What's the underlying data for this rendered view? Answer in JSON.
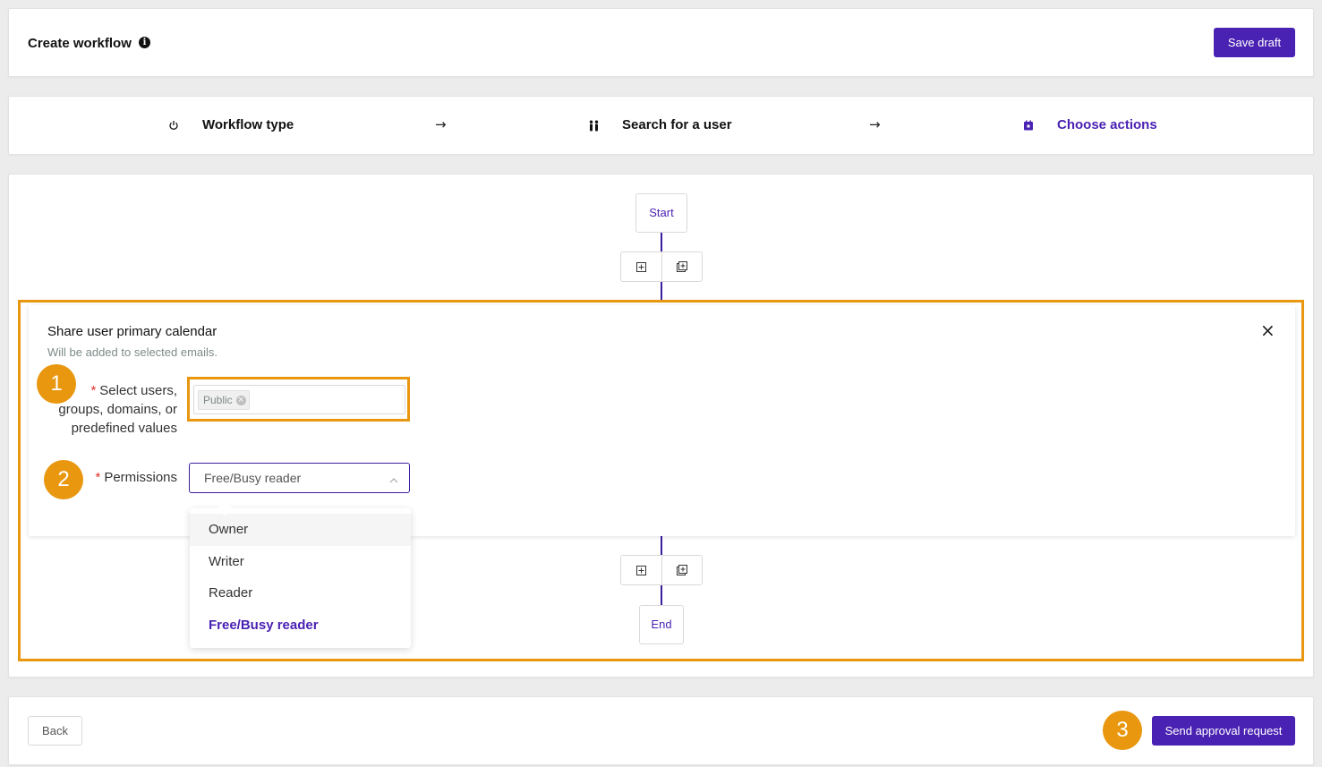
{
  "header": {
    "title": "Create workflow",
    "info_icon": "info-icon",
    "save_label": "Save draft"
  },
  "stepper": {
    "steps": [
      {
        "label": "Workflow type",
        "icon": "power-icon",
        "active": false
      },
      {
        "label": "Search for a user",
        "icon": "users-icon",
        "active": false
      },
      {
        "label": "Choose actions",
        "icon": "calendar-icon",
        "active": true
      }
    ],
    "separator_icon": "arrow-right-icon"
  },
  "flow": {
    "start_label": "Start",
    "end_label": "End",
    "add_icon": "add-action-icon",
    "duplicate_icon": "add-group-icon"
  },
  "action_panel": {
    "title": "Share user primary calendar",
    "subtitle": "Will be added to selected emails.",
    "users_field": {
      "required": "*",
      "label": "Select users, groups, domains, or predefined values",
      "tags": [
        "Public"
      ]
    },
    "permissions_field": {
      "required": "*",
      "label": "Permissions",
      "value": "Free/Busy reader",
      "options": [
        "Owner",
        "Writer",
        "Reader",
        "Free/Busy reader"
      ],
      "selected_index": 3,
      "hover_index": 0
    }
  },
  "annotations": {
    "badges": [
      "1",
      "2",
      "3"
    ],
    "highlight_color": "#e8970f"
  },
  "footer": {
    "back_label": "Back",
    "send_label": "Send approval request"
  },
  "colors": {
    "accent": "#4a22b3",
    "required": "#e0322c",
    "connector": "#3b1d9e"
  }
}
